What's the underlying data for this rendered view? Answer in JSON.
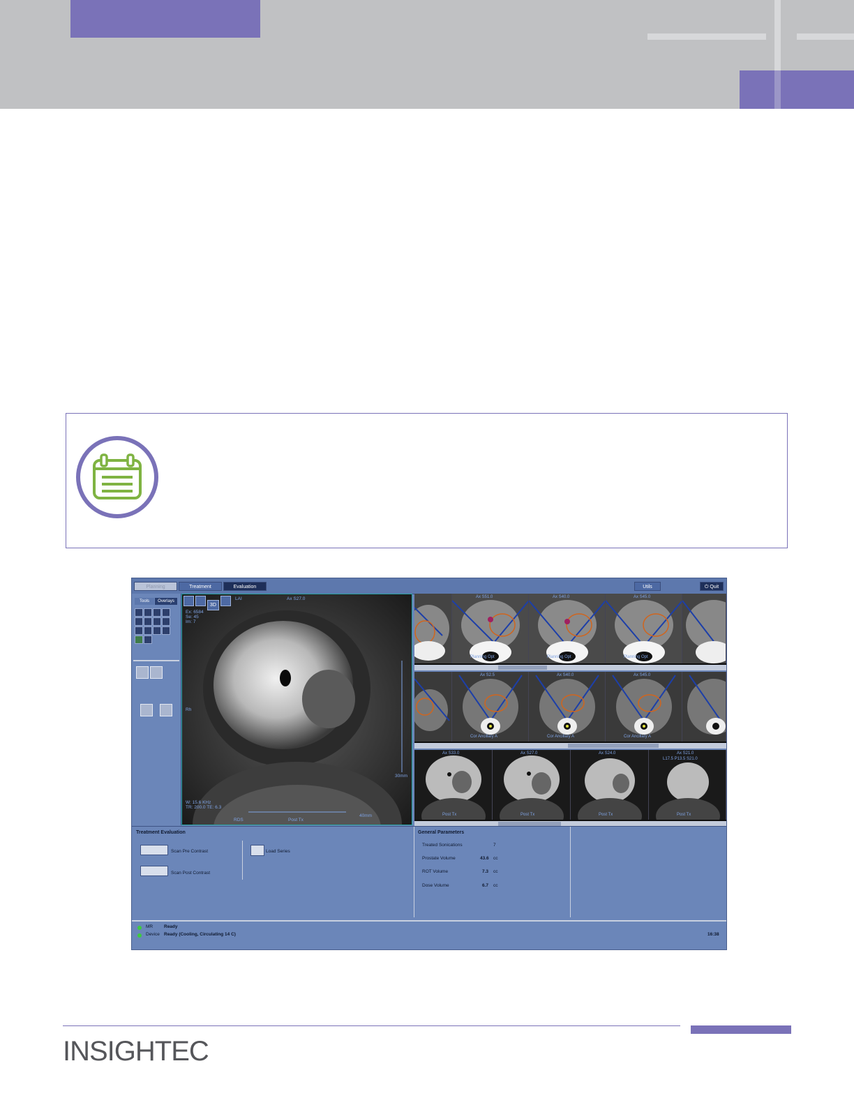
{
  "logo": {
    "text": "INSIGHTEC"
  },
  "note": {
    "icon": "notepad-icon"
  },
  "screenshot": {
    "tabs": [
      "Planning",
      "Treatment",
      "Evaluation"
    ],
    "utils_label": "Utils",
    "quit_label": "Quit",
    "left_tabs": [
      "Tools",
      "Overlays"
    ],
    "main_view": {
      "toolbar_3d": "3D",
      "label_lai": "LAI",
      "label_ax": "Ax S27.0",
      "info_top": [
        "Ex: 6584",
        "Se: 45",
        "Im: 7"
      ],
      "label_left": "Rh",
      "label_right": "30mm",
      "info_bottom": [
        "W: 15.6 KHz",
        "TR: 200.0 TE: 6.3"
      ],
      "label_bottom_left": "RDS",
      "label_bottom_center": "Post Tx",
      "label_bottom_right": "40mm"
    },
    "strip1": {
      "top_labels": [
        "",
        "Ax S51.0",
        "Ax S40.0",
        "Ax S45.0",
        ""
      ],
      "bottom_labels": [
        "",
        "Planning Opt",
        "Planning Opt",
        "Planning Opt",
        ""
      ]
    },
    "strip2": {
      "top_labels": [
        "",
        "Ax S2.5",
        "Ax S40.0",
        "Ax S45.0",
        ""
      ],
      "bottom_labels": [
        "",
        "Cor Ancillary A",
        "Cor Ancillary A",
        "Cor Ancillary A",
        ""
      ]
    },
    "strip3": {
      "top_labels": [
        "Ax S33.0",
        "Ax S27.0",
        "Ax S24.0",
        "Ax S21.0"
      ],
      "extra_label": "L17.5 P13.5 S21.0",
      "bottom_labels": [
        "Post Tx",
        "Post Tx",
        "Post Tx",
        "Post Tx"
      ]
    },
    "treatment_evaluation": {
      "title": "Treatment Evaluation",
      "scan_pre": "Scan Pre Contrast",
      "scan_post": "Scan Post Contrast",
      "load_series": "Load Series"
    },
    "general_parameters": {
      "title": "General Parameters",
      "rows": [
        {
          "label": "Treated Sonications",
          "value": "7",
          "unit": ""
        },
        {
          "label": "Prostate Volume",
          "value": "43.6",
          "unit": "cc"
        },
        {
          "label": "ROT Volume",
          "value": "7.3",
          "unit": "cc"
        },
        {
          "label": "Dose Volume",
          "value": "6.7",
          "unit": "cc"
        }
      ]
    },
    "status": {
      "mr_label": "MR",
      "mr_value": "Ready",
      "device_label": "Device",
      "device_value": "Ready (Cooling, Circulating 14 C)",
      "time": "16:38"
    }
  }
}
